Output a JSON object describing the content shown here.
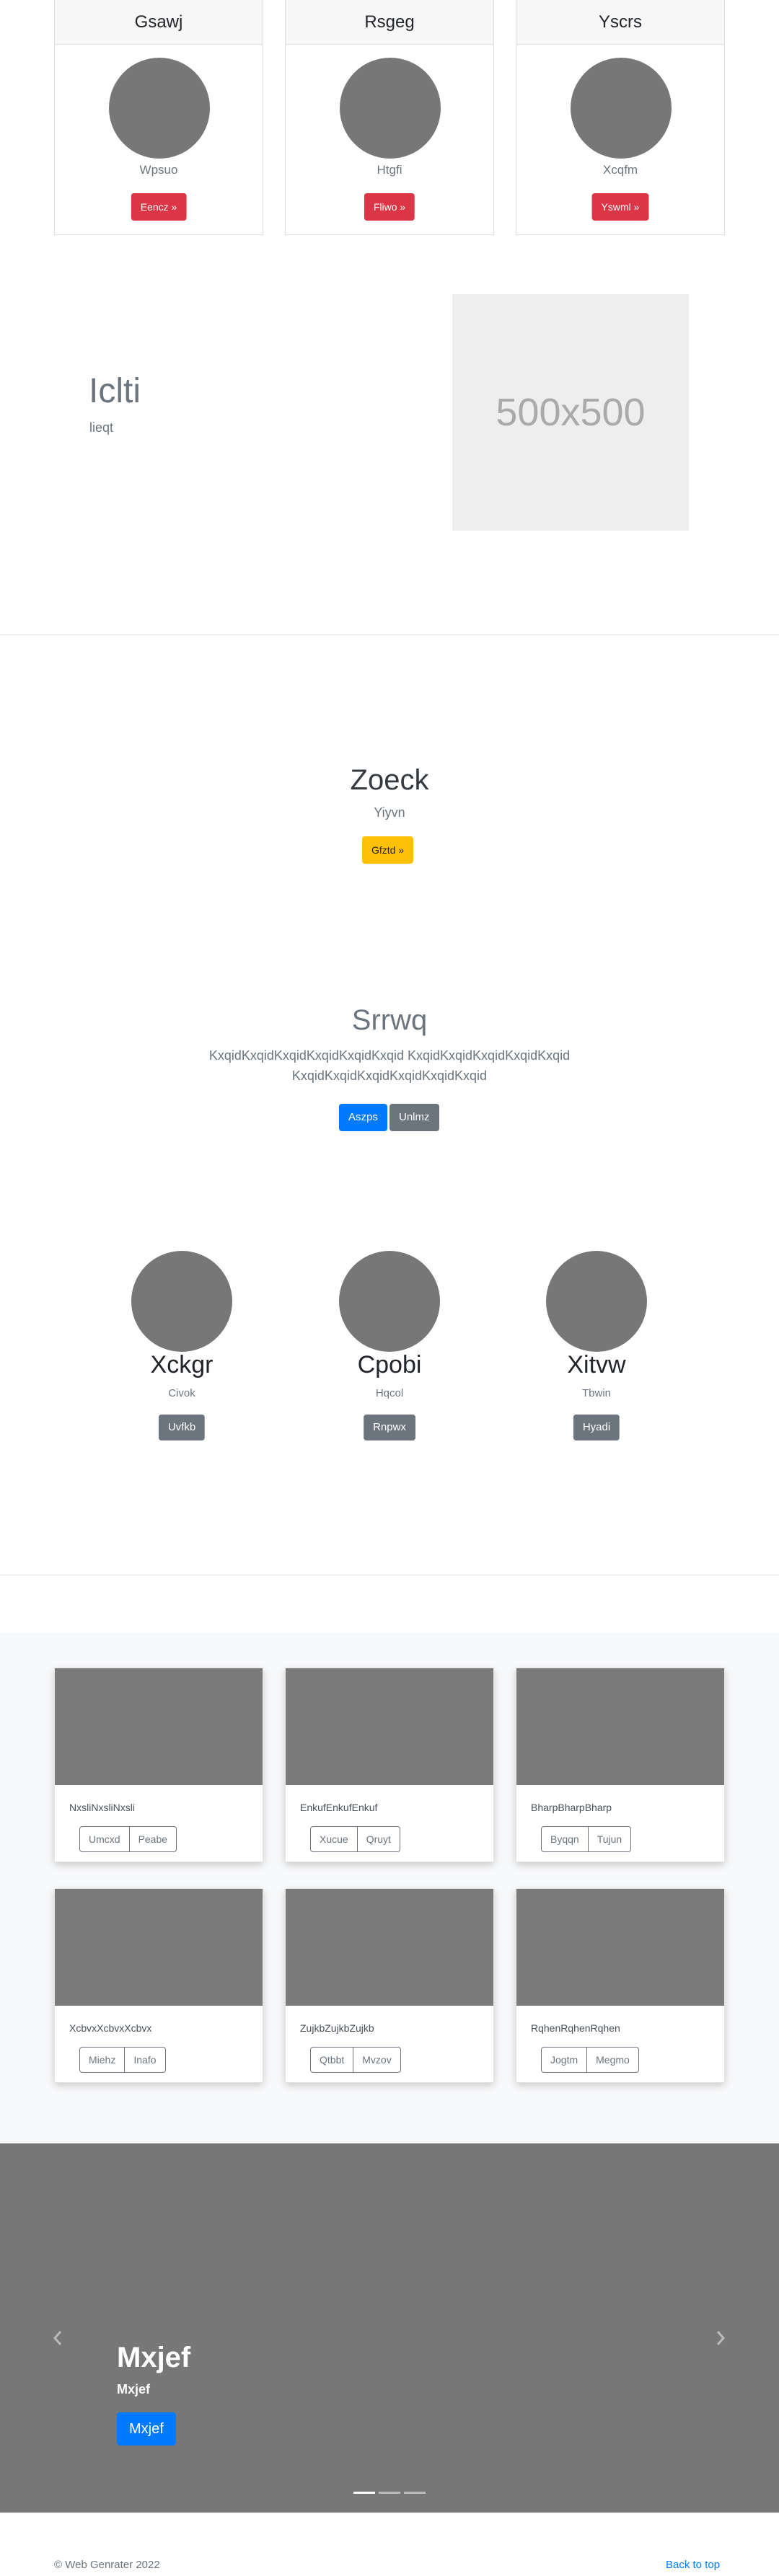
{
  "pricing": {
    "cards": [
      {
        "title": "Gsawj",
        "subtitle": "Wpsuo",
        "button": "Eencz »"
      },
      {
        "title": "Rsgeg",
        "subtitle": "Htgfi",
        "button": "Fliwo »"
      },
      {
        "title": "Yscrs",
        "subtitle": "Xcqfm",
        "button": "Yswml »"
      }
    ]
  },
  "featurette": {
    "heading": "Iclti",
    "lead": "lieqt",
    "placeholder_text": "500x500"
  },
  "hero": {
    "title": "Zoeck",
    "subtitle": "Yiyvn",
    "button": "Gfztd »"
  },
  "jumbotron": {
    "title": "Srrwq",
    "text": "KxqidKxqidKxqidKxqidKxqidKxqid KxqidKxqidKxqidKxqidKxqid KxqidKxqidKxqidKxqidKxqidKxqid",
    "text_line1": "KxqidKxqidKxqidKxqidKxqidKxqid KxqidKxqidKxqidKxqidKxqid",
    "text_line2": "KxqidKxqidKxqidKxqidKxqidKxqid",
    "primary_button": "Aszps",
    "secondary_button": "Unlmz"
  },
  "features": [
    {
      "title": "Xckgr",
      "subtitle": "Civok",
      "button": "Uvfkb"
    },
    {
      "title": "Cpobi",
      "subtitle": "Hqcol",
      "button": "Rnpwx"
    },
    {
      "title": "Xitvw",
      "subtitle": "Tbwin",
      "button": "Hyadi"
    }
  ],
  "album": {
    "cards": [
      {
        "text": "NxsliNxsliNxsli",
        "buttons": [
          "Umcxd",
          "Peabe"
        ]
      },
      {
        "text": "EnkufEnkufEnkuf",
        "buttons": [
          "Xucue",
          "Qruyt"
        ]
      },
      {
        "text": "BharpBharpBharp",
        "buttons": [
          "Byqqn",
          "Tujun"
        ]
      },
      {
        "text": "XcbvxXcbvxXcbvx",
        "buttons": [
          "Miehz",
          "Inafo"
        ]
      },
      {
        "text": "ZujkbZujkbZujkb",
        "buttons": [
          "Qtbbt",
          "Mvzov"
        ]
      },
      {
        "text": "RqhenRqhenRqhen",
        "buttons": [
          "Jogtm",
          "Megmo"
        ]
      }
    ]
  },
  "carousel": {
    "caption_title": "Mxjef",
    "caption_text": "Mxjef",
    "caption_button": "Mxjef",
    "prev_icon": "chevron-left-icon",
    "next_icon": "chevron-right-icon",
    "slide_count": 3,
    "active_slide": 1
  },
  "footer": {
    "copyright": "© Web Genrater 2022",
    "back_to_top": "Back to top"
  },
  "colors": {
    "danger": "#dc3545",
    "warning": "#ffc107",
    "primary": "#007bff",
    "secondary": "#6c757d",
    "placeholder_gray": "#777777",
    "link": "#007bff"
  }
}
